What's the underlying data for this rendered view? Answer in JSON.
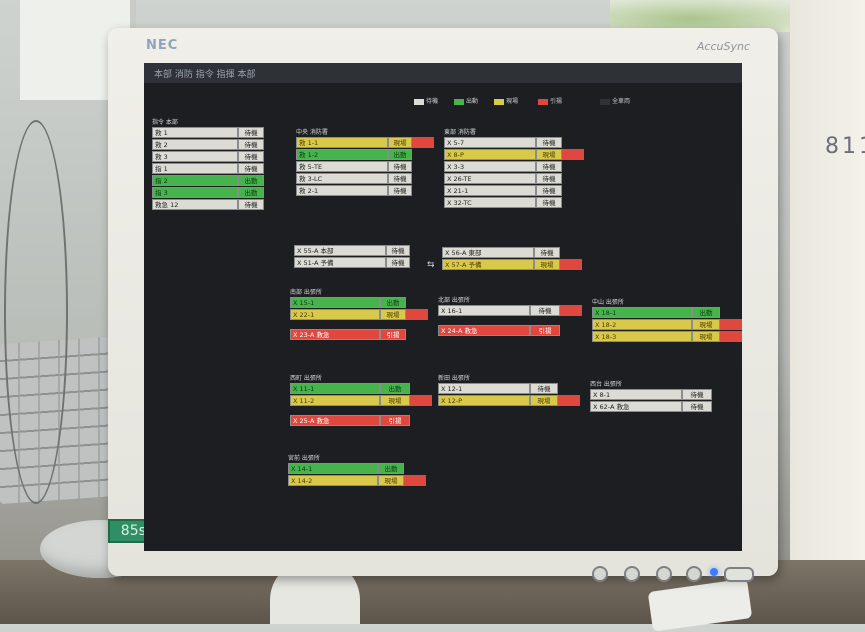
{
  "brand": "NEC",
  "model": "AccuSync",
  "asset_tag": "85ss",
  "screen": {
    "title": "本部 消防 指令 指揮 本部",
    "legend": [
      {
        "label": "待機",
        "color": "#dcdcd5"
      },
      {
        "label": "出動",
        "color": "#47b34c"
      },
      {
        "label": "現場",
        "color": "#d8c94a"
      },
      {
        "label": "引揚",
        "color": "#e0473f"
      },
      {
        "label": "全車両",
        "color": "#2e3238"
      }
    ],
    "groups": [
      {
        "heading": "指令 本部",
        "rows": [
          {
            "label": "救 1",
            "status": "待機",
            "color": "white",
            "ext": ""
          },
          {
            "label": "救 2",
            "status": "待機",
            "color": "white",
            "ext": ""
          },
          {
            "label": "救 3",
            "status": "待機",
            "color": "white",
            "ext": ""
          },
          {
            "label": "指 1",
            "status": "待機",
            "color": "white",
            "ext": ""
          },
          {
            "label": "指 2",
            "status": "出動",
            "color": "green",
            "ext": ""
          },
          {
            "label": "指 3",
            "status": "出動",
            "color": "green",
            "ext": ""
          },
          {
            "label": "救急 12",
            "status": "待機",
            "color": "white",
            "ext": ""
          }
        ]
      },
      {
        "heading": "中央 消防署",
        "rows": [
          {
            "label": "救 1-1",
            "status": "現場",
            "color": "yellow",
            "ext": "red"
          },
          {
            "label": "救 1-2",
            "status": "出動",
            "color": "green",
            "ext": ""
          },
          {
            "label": "救 5-TE",
            "status": "待機",
            "color": "white",
            "ext": ""
          },
          {
            "label": "救 3-LC",
            "status": "待機",
            "color": "white",
            "ext": ""
          },
          {
            "label": "救 2-1",
            "status": "待機",
            "color": "white",
            "ext": ""
          }
        ]
      },
      {
        "heading": "東部 消防署",
        "rows": [
          {
            "label": "X 5-7",
            "status": "待機",
            "color": "white",
            "ext": ""
          },
          {
            "label": "X 8-P",
            "status": "現場",
            "color": "yellow",
            "ext": "red"
          },
          {
            "label": "X 3-3",
            "status": "待機",
            "color": "white",
            "ext": ""
          },
          {
            "label": "X 26-TE",
            "status": "待機",
            "color": "white",
            "ext": ""
          },
          {
            "label": "X 21-1",
            "status": "待機",
            "color": "white",
            "ext": ""
          },
          {
            "label": "X 32-TC",
            "status": "待機",
            "color": "white",
            "ext": ""
          }
        ]
      },
      {
        "heading": "",
        "rows": [
          {
            "label": "X 55-A 本部",
            "status": "待機",
            "color": "white",
            "ext": ""
          },
          {
            "label": "X 51-A 予備",
            "status": "待機",
            "color": "white",
            "ext": ""
          }
        ]
      },
      {
        "heading": "",
        "rows": [
          {
            "label": "X 56-A 東部",
            "status": "待機",
            "color": "white",
            "ext": ""
          },
          {
            "label": "X 57-A 予備",
            "status": "現場",
            "color": "yellow",
            "ext": "red"
          }
        ]
      },
      {
        "heading": "南部 出張所",
        "rows": [
          {
            "label": "X 15-1",
            "status": "出動",
            "color": "green",
            "ext": ""
          },
          {
            "label": "X 22-1",
            "status": "現場",
            "color": "yellow",
            "ext": "red"
          },
          {
            "label": "X 23-A 救急",
            "status": "引揚",
            "color": "red",
            "ext": ""
          }
        ]
      },
      {
        "heading": "北部 出張所",
        "rows": [
          {
            "label": "X 16-1",
            "status": "待機",
            "color": "white",
            "ext": "red"
          },
          {
            "label": "X 24-A 救急",
            "status": "引揚",
            "color": "red",
            "ext": ""
          }
        ]
      },
      {
        "heading": "中山 出張所",
        "rows": [
          {
            "label": "X 18-1",
            "status": "出動",
            "color": "green",
            "ext": ""
          },
          {
            "label": "X 18-2",
            "status": "現場",
            "color": "yellow",
            "ext": "red"
          },
          {
            "label": "X 18-3",
            "status": "現場",
            "color": "yellow",
            "ext": "red"
          }
        ]
      },
      {
        "heading": "西町 出張所",
        "rows": [
          {
            "label": "X 11-1",
            "status": "出動",
            "color": "green",
            "ext": ""
          },
          {
            "label": "X 11-2",
            "status": "現場",
            "color": "yellow",
            "ext": "red"
          },
          {
            "label": "X 25-A 救急",
            "status": "引揚",
            "color": "red",
            "ext": ""
          }
        ]
      },
      {
        "heading": "新田 出張所",
        "rows": [
          {
            "label": "X 12-1",
            "status": "待機",
            "color": "white",
            "ext": ""
          },
          {
            "label": "X 12-P",
            "status": "現場",
            "color": "yellow",
            "ext": "red"
          }
        ]
      },
      {
        "heading": "西台 出張所",
        "rows": [
          {
            "label": "X 8-1",
            "status": "待機",
            "color": "white",
            "ext": ""
          },
          {
            "label": "X 62-A 救急",
            "status": "待機",
            "color": "white",
            "ext": ""
          }
        ]
      },
      {
        "heading": "宮前 出張所",
        "rows": [
          {
            "label": "X 14-1",
            "status": "出動",
            "color": "green",
            "ext": ""
          },
          {
            "label": "X 14-2",
            "status": "現場",
            "color": "yellow",
            "ext": "red"
          }
        ]
      }
    ]
  }
}
